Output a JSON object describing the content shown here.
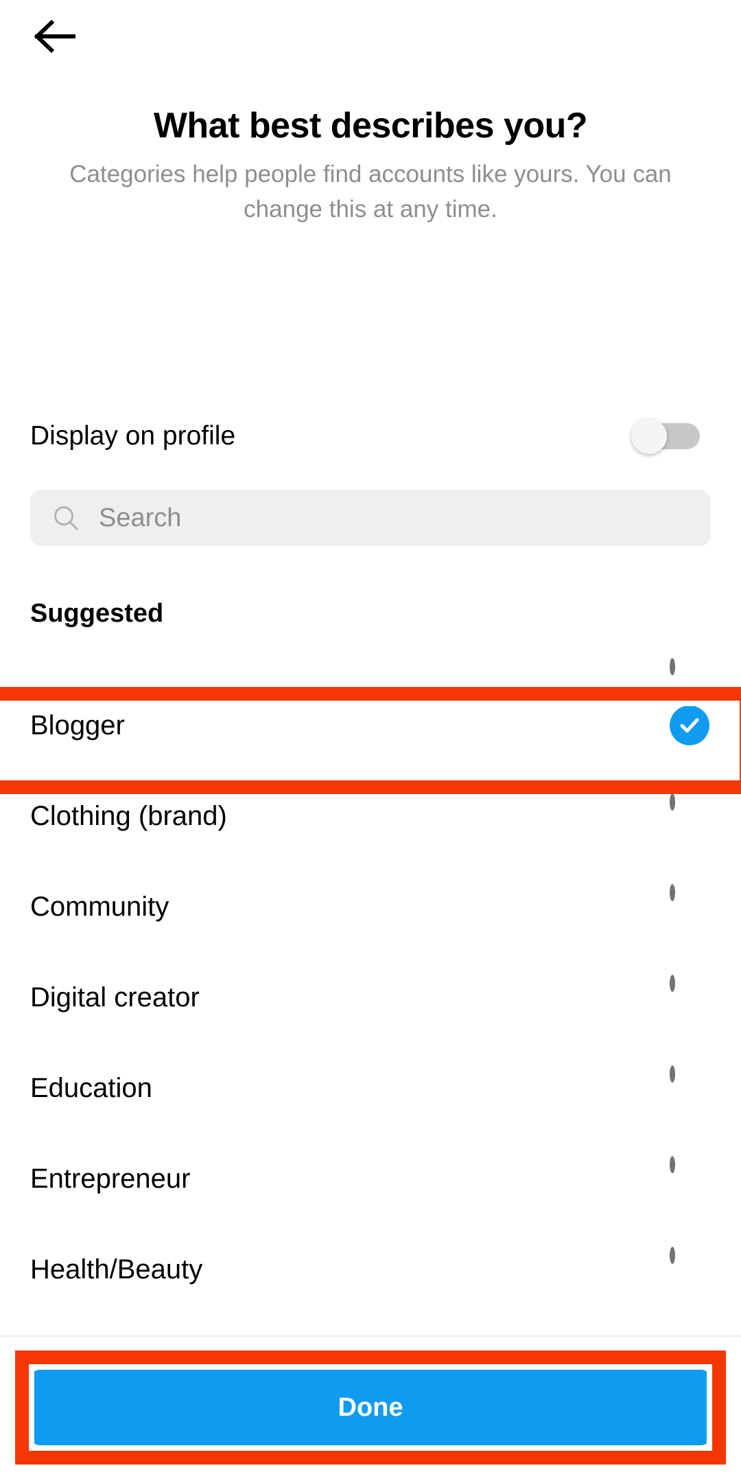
{
  "header": {
    "back_icon": "arrow-left-icon"
  },
  "page": {
    "title": "What best describes you?",
    "subtitle": "Categories help people find accounts like yours. You can change this at any time."
  },
  "display_toggle": {
    "label": "Display on profile",
    "state": "off"
  },
  "search": {
    "icon": "search-icon",
    "placeholder": "Search",
    "value": ""
  },
  "list": {
    "section_header": "Suggested",
    "rows": [
      {
        "label": "",
        "selected": false,
        "partial": true
      },
      {
        "label": "Blogger",
        "selected": true,
        "partial": false
      },
      {
        "label": "Clothing (brand)",
        "selected": false,
        "partial": false
      },
      {
        "label": "Community",
        "selected": false,
        "partial": false
      },
      {
        "label": "Digital creator",
        "selected": false,
        "partial": false
      },
      {
        "label": "Education",
        "selected": false,
        "partial": false
      },
      {
        "label": "Entrepreneur",
        "selected": false,
        "partial": false
      },
      {
        "label": "Health/Beauty",
        "selected": false,
        "partial": false
      }
    ]
  },
  "footer": {
    "done_label": "Done"
  },
  "colors": {
    "accent_blue": "#0f9cf0",
    "highlight_red": "#f53703",
    "muted_text": "#8e8e8e",
    "search_bg": "#efefef",
    "toggle_track": "#c7c7c7",
    "radio_outline": "#737373"
  }
}
